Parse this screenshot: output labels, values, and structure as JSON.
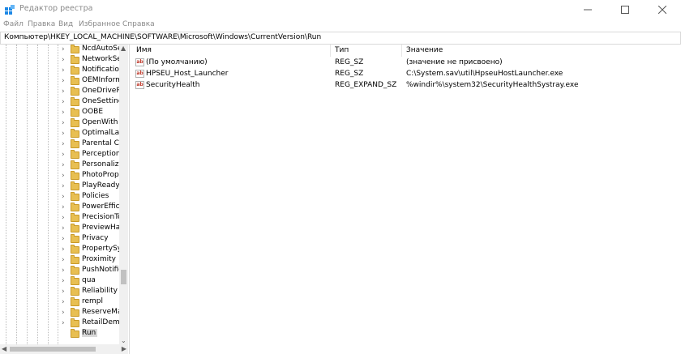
{
  "window": {
    "title": "Редактор реестра"
  },
  "menu": [
    "Файл",
    "Правка",
    "Вид",
    "Избранное",
    "Справка"
  ],
  "address": {
    "path": "Компьютер\\HKEY_LOCAL_MACHINE\\SOFTWARE\\Microsoft\\Windows\\CurrentVersion\\Run"
  },
  "tree": {
    "items": [
      {
        "label": "NcdAutoSe"
      },
      {
        "label": "NetworkSer"
      },
      {
        "label": "Notification"
      },
      {
        "label": "OEMInform"
      },
      {
        "label": "OneDriveRa"
      },
      {
        "label": "OneSettings"
      },
      {
        "label": "OOBE"
      },
      {
        "label": "OpenWith"
      },
      {
        "label": "OptimalLay"
      },
      {
        "label": "Parental Co"
      },
      {
        "label": "PerceptionS"
      },
      {
        "label": "Personalizat"
      },
      {
        "label": "PhotoPrope"
      },
      {
        "label": "PlayReady"
      },
      {
        "label": "Policies"
      },
      {
        "label": "PowerEfficie"
      },
      {
        "label": "PrecisionTo"
      },
      {
        "label": "PreviewHan"
      },
      {
        "label": "Privacy"
      },
      {
        "label": "PropertySys"
      },
      {
        "label": "Proximity"
      },
      {
        "label": "PushNotifica"
      },
      {
        "label": "qua"
      },
      {
        "label": "Reliability"
      },
      {
        "label": "rempl"
      },
      {
        "label": "ReserveMar"
      },
      {
        "label": "RetailDemo"
      },
      {
        "label": "Run",
        "selected": true
      }
    ]
  },
  "columns": {
    "name": "Имя",
    "type": "Тип",
    "value": "Значение"
  },
  "values": [
    {
      "name": "(По умолчанию)",
      "type": "REG_SZ",
      "data": "(значение не присвоено)"
    },
    {
      "name": "HPSEU_Host_Launcher",
      "type": "REG_SZ",
      "data": "C:\\System.sav\\util\\HpseuHostLauncher.exe"
    },
    {
      "name": "SecurityHealth",
      "type": "REG_EXPAND_SZ",
      "data": "%windir%\\system32\\SecurityHealthSystray.exe"
    }
  ],
  "colors": {
    "folder": "#e8bf52",
    "selected": "#d9d9d9",
    "icon_blue": "#1e88e5"
  },
  "icons": {
    "value_string": "ab"
  }
}
